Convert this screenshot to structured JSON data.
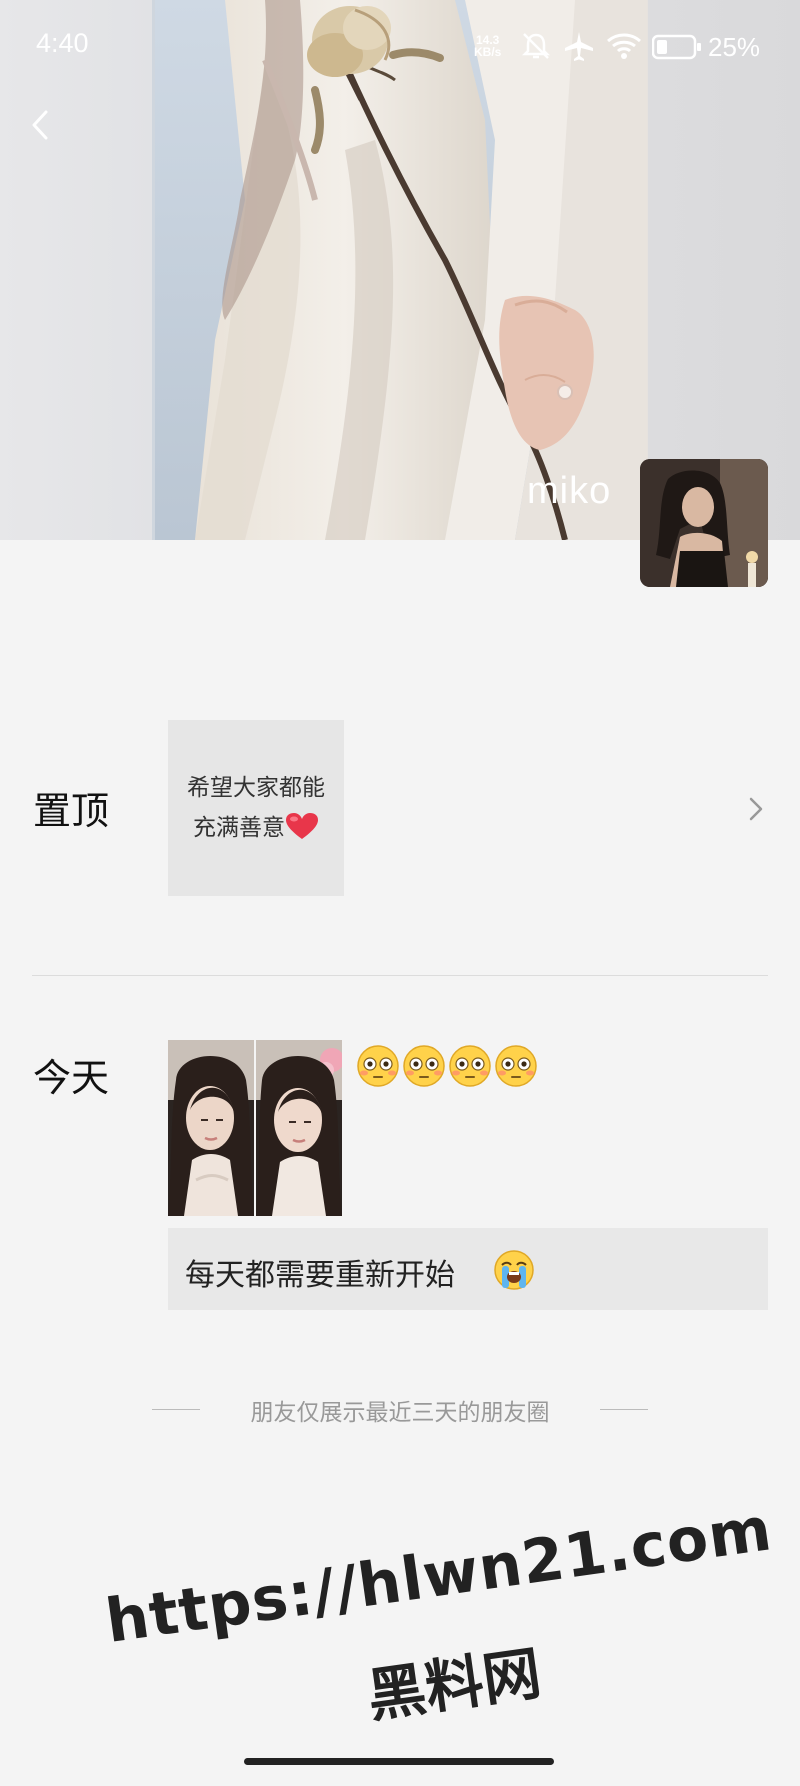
{
  "status_bar": {
    "time": "4:40",
    "net_speed_value": "14.3",
    "net_speed_unit": "KB/s",
    "battery_percent": "25%"
  },
  "profile": {
    "name": "miko"
  },
  "pinned": {
    "label": "置顶",
    "card_line1": "希望大家都能",
    "card_line2": "充满善意",
    "card_emoji": "red-heart-icon"
  },
  "today": {
    "label": "今天",
    "emoji_count": 4,
    "emoji": "flushed-face-icon",
    "post_text": "每天都需要重新开始",
    "post_emoji": "loudly-crying-face-icon"
  },
  "footer_notice": "朋友仅展示最近三天的朋友圈",
  "watermark": {
    "url": "https://hlwn21.com",
    "name": "黑料网"
  },
  "colors": {
    "background": "#f4f4f4",
    "card_bg": "#e6e6e6",
    "watermark": "#222222"
  }
}
